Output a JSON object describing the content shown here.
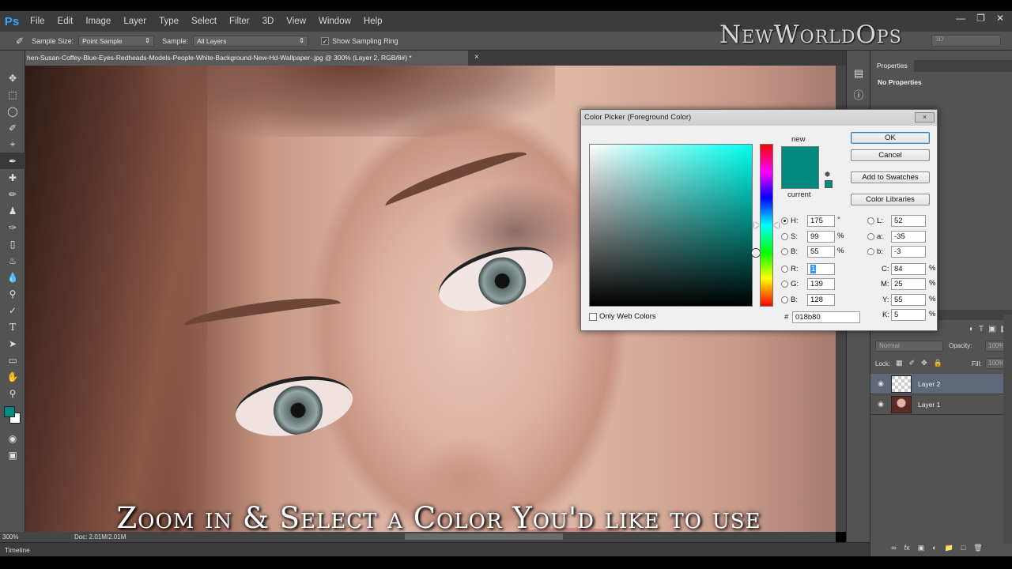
{
  "menubar": {
    "app_logo": "Ps",
    "items": [
      "File",
      "Edit",
      "Image",
      "Layer",
      "Type",
      "Select",
      "Filter",
      "3D",
      "View",
      "Window",
      "Help"
    ]
  },
  "options_bar": {
    "sample_size_label": "Sample Size:",
    "sample_size_value": "Point Sample",
    "sample_label": "Sample:",
    "sample_value": "All Layers",
    "show_ring_label": "Show Sampling Ring",
    "show_ring_checked": "✓"
  },
  "brand_watermark": "NewWorldOps",
  "workspace_value": "3D",
  "document": {
    "tab_title": "hen-Susan-Coffey-Blue-Eyes-Redheads-Models-People-White-Background-New-Hd-Wallpaper-.jpg @ 300% (Layer 2, RGB/8#) *",
    "tab_close": "×"
  },
  "caption": "Zoom in & Select a Color You'd like to use",
  "status": {
    "zoom": "300%",
    "doc": "Doc: 2.01M/2.01M",
    "timeline": "Timeline"
  },
  "properties_panel": {
    "tab": "Properties",
    "content": "No Properties"
  },
  "layers_panel": {
    "blend_mode": "Normal",
    "opacity_label": "Opacity:",
    "opacity_value": "100%",
    "lock_label": "Lock:",
    "fill_label": "Fill:",
    "fill_value": "100%",
    "layers": [
      {
        "name": "Layer 2",
        "selected": true
      },
      {
        "name": "Layer 1",
        "selected": false
      }
    ]
  },
  "color_picker": {
    "title": "Color Picker (Foreground Color)",
    "close": "×",
    "new_label": "new",
    "current_label": "current",
    "new_color": "#018b80",
    "current_color": "#018b80",
    "buttons": {
      "ok": "OK",
      "cancel": "Cancel",
      "add_swatches": "Add to Swatches",
      "color_libraries": "Color Libraries"
    },
    "hsb": {
      "h_label": "H:",
      "h_value": "175",
      "h_unit": "°",
      "s_label": "S:",
      "s_value": "99",
      "s_unit": "%",
      "b_label": "B:",
      "b_value": "55",
      "b_unit": "%"
    },
    "rgb": {
      "r_label": "R:",
      "r_value": "1",
      "g_label": "G:",
      "g_value": "139",
      "b_label": "B:",
      "b_value": "128"
    },
    "lab": {
      "l_label": "L:",
      "l_value": "52",
      "a_label": "a:",
      "a_value": "-35",
      "b_label": "b:",
      "b_value": "-3"
    },
    "cmyk": {
      "c_label": "C:",
      "c_value": "84",
      "m_label": "M:",
      "m_value": "25",
      "y_label": "Y:",
      "y_value": "55",
      "k_label": "K:",
      "k_value": "5",
      "unit": "%"
    },
    "hex_label": "#",
    "hex_value": "018b80",
    "web_colors_label": "Only Web Colors"
  }
}
